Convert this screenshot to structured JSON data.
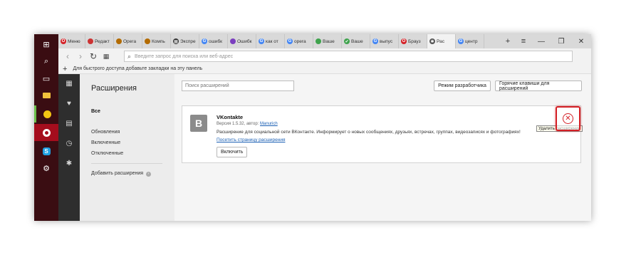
{
  "taskbar": {
    "icons": [
      "windows-logo-icon",
      "search-icon",
      "task-view-icon",
      "file-explorer-icon",
      "app-icon",
      "opera-icon",
      "skype-icon",
      "settings-icon"
    ]
  },
  "tabs": [
    {
      "label": "Меню",
      "color": "#d42026",
      "glyph": "O"
    },
    {
      "label": "Редакт",
      "color": "#cc3333",
      "glyph": ""
    },
    {
      "label": "Opera",
      "color": "#b36b00",
      "glyph": ""
    },
    {
      "label": "Компь",
      "color": "#b36b00",
      "glyph": ""
    },
    {
      "label": "Экспре",
      "color": "#333333",
      "glyph": "▦"
    },
    {
      "label": "ошибк",
      "color": "#4285f4",
      "glyph": "G"
    },
    {
      "label": "Ошибк",
      "color": "#7b3fbf",
      "glyph": ""
    },
    {
      "label": "как от",
      "color": "#4285f4",
      "glyph": "G"
    },
    {
      "label": "opera",
      "color": "#4285f4",
      "glyph": "G"
    },
    {
      "label": "Ваше",
      "color": "#3fa34d",
      "glyph": ""
    },
    {
      "label": "Ваше",
      "color": "#3fa34d",
      "glyph": "✔"
    },
    {
      "label": "выпус",
      "color": "#4285f4",
      "glyph": "G"
    },
    {
      "label": "Брауз",
      "color": "#d42026",
      "glyph": "O"
    },
    {
      "label": "Рас",
      "color": "#555555",
      "glyph": "✱"
    },
    {
      "label": "центр",
      "color": "#4285f4",
      "glyph": "G"
    }
  ],
  "active_tab_index": 13,
  "address": {
    "placeholder": "Введите запрос для поиска или веб-адрес"
  },
  "bookmarks": {
    "hint": "Для быстрого доступа добавьте закладки на эту панель"
  },
  "nav": {
    "title": "Расширения",
    "all": "Все",
    "updates": "Обновления",
    "enabled": "Включенные",
    "disabled": "Отключенные",
    "add": "Добавить расширения"
  },
  "main": {
    "search_placeholder": "Поиск расширений",
    "dev_mode": "Режим разработчика",
    "hotkeys": "Горячие клавиши для расширений"
  },
  "extension": {
    "icon_letter": "B",
    "name": "VKontakte",
    "version_prefix": "Версия 1.5.32, автор:",
    "author": "Manurich",
    "description": "Расширение для социальной сети ВКонтакте. Информирует о новых сообщениях, друзьях, встречах, группах, видеозаписях и фотографиях!",
    "page_link": "Посетить страницу расширения",
    "enable_button": "Включить",
    "remove_tooltip": "Удалить расширение",
    "remove_icon": "close-icon"
  }
}
